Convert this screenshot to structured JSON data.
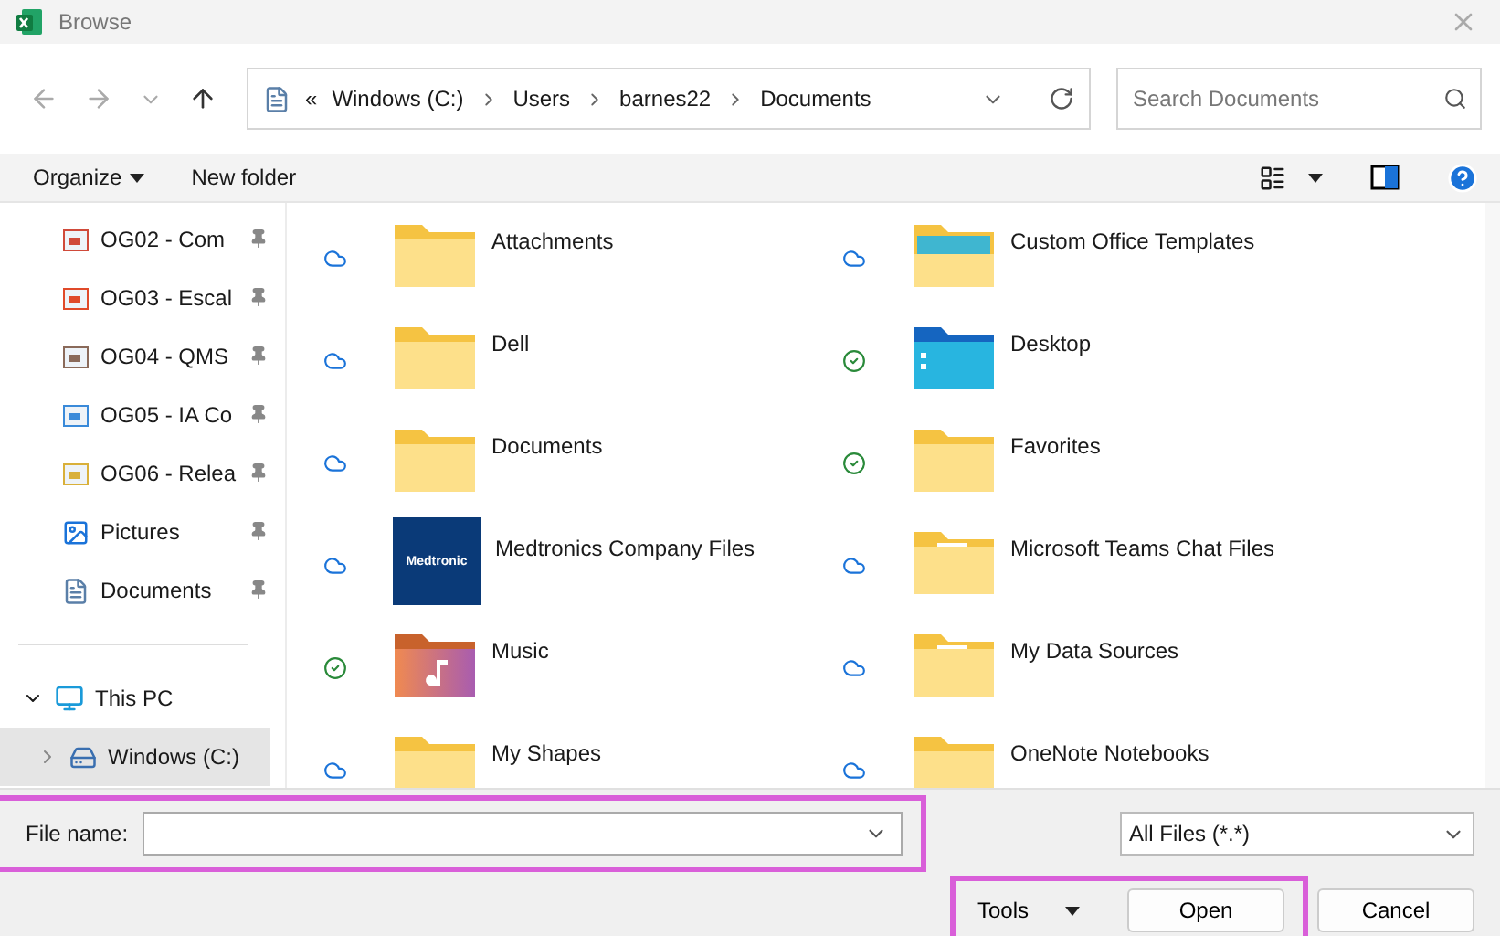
{
  "window": {
    "title": "Browse"
  },
  "address": {
    "overflow": "«",
    "segments": [
      "Windows (C:)",
      "Users",
      "barnes22",
      "Documents"
    ]
  },
  "search": {
    "placeholder": "Search Documents"
  },
  "commands": {
    "organize": "Organize",
    "new_folder": "New folder"
  },
  "sidebar": {
    "items": [
      {
        "label": "OG02 - Com",
        "kind": "ppt",
        "pinned": true
      },
      {
        "label": "OG03 - Escal",
        "kind": "stairs",
        "pinned": true
      },
      {
        "label": "OG04 - QMS",
        "kind": "board",
        "pinned": true
      },
      {
        "label": "OG05 - IA Co",
        "kind": "chart",
        "pinned": true
      },
      {
        "label": "OG06 - Relea",
        "kind": "calendar",
        "pinned": true
      },
      {
        "label": "Pictures",
        "kind": "pictures",
        "pinned": true
      },
      {
        "label": "Documents",
        "kind": "documents",
        "pinned": true
      }
    ],
    "tree": [
      {
        "label": "This PC",
        "kind": "pc",
        "expanded": true,
        "selected": false,
        "children": [
          {
            "label": "Windows (C:)",
            "kind": "drive",
            "expanded": false,
            "selected": true
          }
        ]
      }
    ]
  },
  "files": [
    {
      "name": "Attachments",
      "kind": "folder",
      "synced": false
    },
    {
      "name": "Custom Office Templates",
      "kind": "templates",
      "synced": false
    },
    {
      "name": "Dell",
      "kind": "folder",
      "synced": false
    },
    {
      "name": "Desktop",
      "kind": "desktop",
      "synced": true
    },
    {
      "name": "Documents",
      "kind": "folder",
      "synced": false
    },
    {
      "name": "Favorites",
      "kind": "folder",
      "synced": true
    },
    {
      "name": "Medtronics Company Files",
      "kind": "logo",
      "logo_text": "Medtronic",
      "synced": false
    },
    {
      "name": "Microsoft Teams Chat Files",
      "kind": "excel",
      "synced": false
    },
    {
      "name": "Music",
      "kind": "music",
      "synced": true
    },
    {
      "name": "My Data Sources",
      "kind": "excel",
      "synced": false
    },
    {
      "name": "My Shapes",
      "kind": "folder",
      "synced": false
    },
    {
      "name": "OneNote Notebooks",
      "kind": "folder",
      "synced": false
    }
  ],
  "footer": {
    "file_name_label": "File name:",
    "file_type": "All Files (*.*)",
    "tools": "Tools",
    "open": "Open",
    "cancel": "Cancel",
    "highlight_file_name": true,
    "highlight_actions": true
  }
}
